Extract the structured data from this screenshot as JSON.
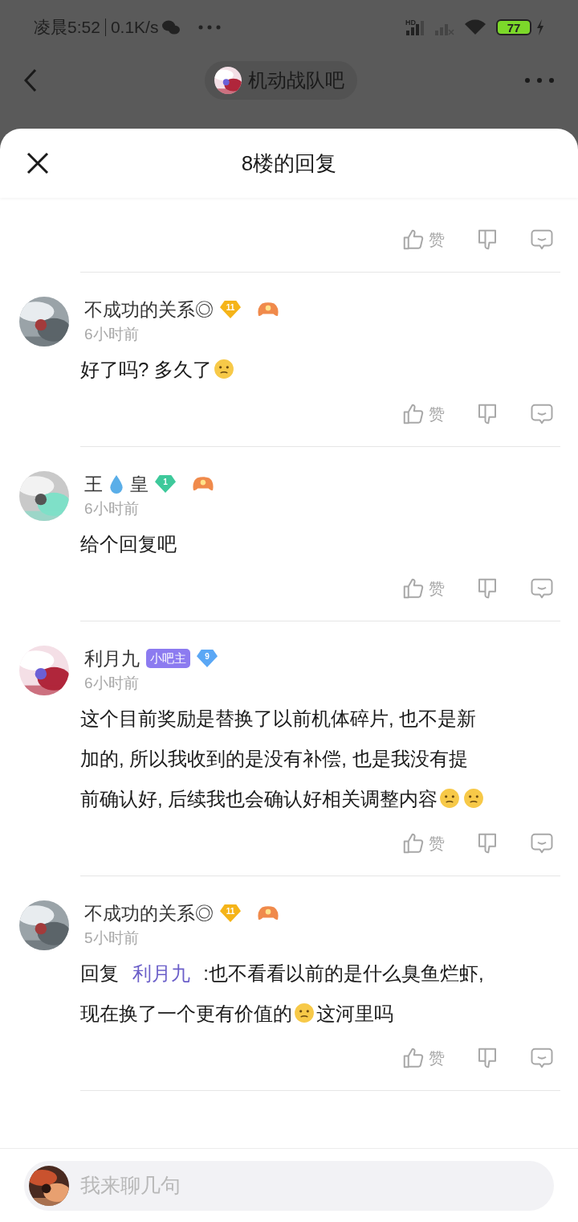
{
  "status_bar": {
    "time": "凌晨5:52",
    "speed": "0.1K/s",
    "network": "HD",
    "battery": "77"
  },
  "nav": {
    "title": "机动战队吧"
  },
  "sheet": {
    "title": "8楼的回复"
  },
  "top_actions": {
    "like_label": "赞"
  },
  "comments": [
    {
      "name": [
        {
          "kind": "text",
          "text": "不成功的关系◎"
        }
      ],
      "badges": [
        {
          "kind": "level",
          "text": "11",
          "color": "#f5b419"
        },
        {
          "kind": "game"
        }
      ],
      "time": "6小时前",
      "lines": [
        [
          {
            "kind": "text",
            "text": "好了吗? 多久了"
          },
          {
            "kind": "emoji"
          }
        ]
      ],
      "like_label": "赞"
    },
    {
      "name": [
        {
          "kind": "text",
          "text": "王"
        },
        {
          "kind": "drop"
        },
        {
          "kind": "text",
          "text": "皇"
        }
      ],
      "badges": [
        {
          "kind": "level",
          "text": "1",
          "color": "#3ec99b"
        },
        {
          "kind": "game"
        }
      ],
      "time": "6小时前",
      "lines": [
        [
          {
            "kind": "text",
            "text": "给个回复吧"
          }
        ]
      ],
      "like_label": "赞"
    },
    {
      "name": [
        {
          "kind": "text",
          "text": "利月九"
        }
      ],
      "badges": [
        {
          "kind": "role",
          "text": "小吧主"
        },
        {
          "kind": "level",
          "text": "9",
          "color": "#5aa7f5"
        }
      ],
      "time": "6小时前",
      "lines": [
        [
          {
            "kind": "text",
            "text": "这个目前奖励是替换了以前机体碎片, 也不是新"
          }
        ],
        [
          {
            "kind": "text",
            "text": "加的, 所以我收到的是没有补偿, 也是我没有提"
          }
        ],
        [
          {
            "kind": "text",
            "text": "前确认好, 后续我也会确认好相关调整内容"
          },
          {
            "kind": "emoji"
          },
          {
            "kind": "emoji"
          }
        ]
      ],
      "like_label": "赞"
    },
    {
      "name": [
        {
          "kind": "text",
          "text": "不成功的关系◎"
        }
      ],
      "badges": [
        {
          "kind": "level",
          "text": "11",
          "color": "#f5b419"
        },
        {
          "kind": "game"
        }
      ],
      "time": "5小时前",
      "lines": [
        [
          {
            "kind": "text",
            "text": "回复 "
          },
          {
            "kind": "mention",
            "text": "利月九"
          },
          {
            "kind": "text",
            "text": " :也不看看以前的是什么臭鱼烂虾,"
          }
        ],
        [
          {
            "kind": "text",
            "text": "现在换了一个更有价值的"
          },
          {
            "kind": "emoji"
          },
          {
            "kind": "text",
            "text": "这河里吗"
          }
        ]
      ],
      "like_label": "赞"
    }
  ],
  "input": {
    "placeholder": "我来聊几句"
  }
}
